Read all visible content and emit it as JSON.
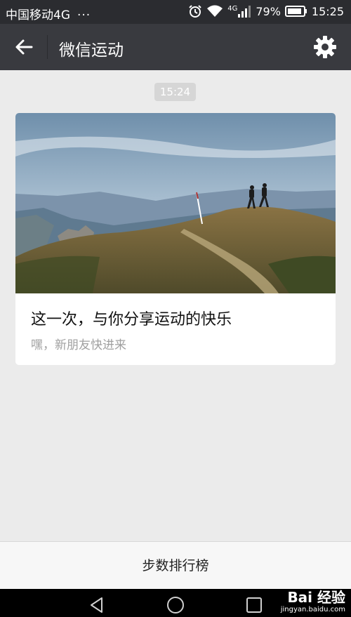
{
  "status_bar": {
    "carrier": "中国移动4G",
    "more": "···",
    "network_label": "4G",
    "battery": "79%",
    "time": "15:25"
  },
  "nav": {
    "title": "微信运动"
  },
  "chat": {
    "timestamp": "15:24",
    "card": {
      "headline": "这一次，与你分享运动的快乐",
      "subline": "嘿，新朋友快进来"
    }
  },
  "bottom": {
    "rank_label": "步数排行榜"
  },
  "watermark": {
    "brand": "Bai 经验",
    "domain": "jingyan.baidu.com"
  },
  "colors": {
    "status_bar_bg": "#2b2c30",
    "nav_bar_bg": "#393a3f",
    "page_bg": "#ebebeb",
    "card_bg": "#ffffff"
  },
  "icons": [
    "alarm-icon",
    "wifi-icon",
    "signal-icon",
    "battery-icon",
    "back-arrow-icon",
    "gear-icon",
    "nav-back-icon",
    "nav-home-icon",
    "nav-recent-icon"
  ]
}
